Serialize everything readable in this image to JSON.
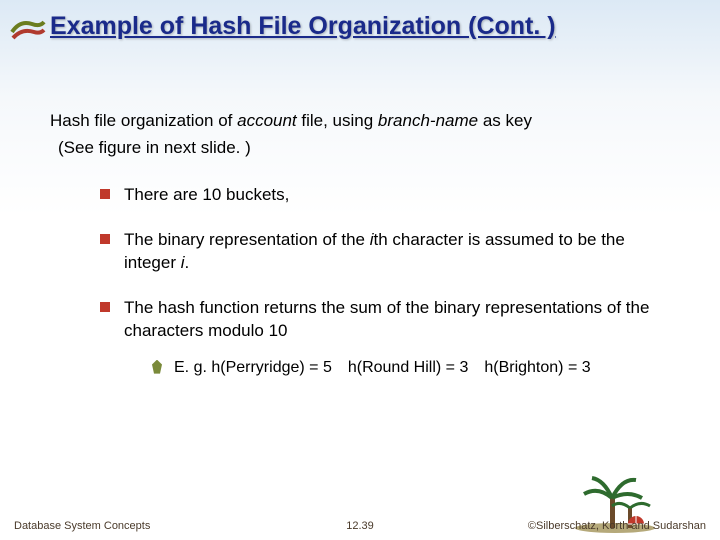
{
  "title": "Example of Hash File Organization (Cont. )",
  "intro": {
    "line1_a": "Hash file organization of ",
    "line1_b": "account",
    "line1_c": " file, using ",
    "line1_d": "branch-name",
    "line1_e": " as key",
    "line2": "(See figure in next slide. )"
  },
  "bullets": {
    "b1": "There are 10 buckets,",
    "b2_a": "The binary representation of the ",
    "b2_b": "i",
    "b2_c": "th character is assumed to be the integer ",
    "b2_d": "i",
    "b2_e": ".",
    "b3": "The hash function returns the sum of the binary representations of the characters modulo 10",
    "sub1": "E. g. h(Perryridge) = 5 h(Round Hill) = 3 h(Brighton) = 3"
  },
  "footer": {
    "left": "Database System Concepts",
    "center": "12.39",
    "right": "©Silberschatz, Korth and Sudarshan"
  }
}
